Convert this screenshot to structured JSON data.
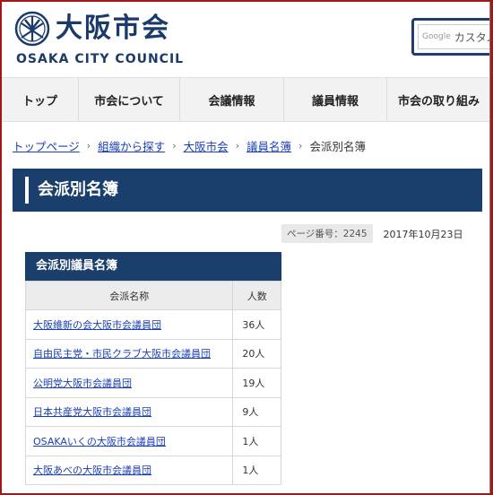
{
  "header": {
    "logo_jp": "大阪市会",
    "logo_en": "OSAKA CITY COUNCIL",
    "search_google": "Google",
    "search_placeholder": "カスタム検"
  },
  "nav": [
    {
      "label": "トップ"
    },
    {
      "label": "市会について"
    },
    {
      "label": "会議情報"
    },
    {
      "label": "議員情報"
    },
    {
      "label": "市会の取り組み"
    }
  ],
  "breadcrumb": {
    "items": [
      "トップページ",
      "組織から探す",
      "大阪市会",
      "議員名簿"
    ],
    "separator": "›",
    "current": "会派別名簿"
  },
  "page_title": "会派別名簿",
  "meta": {
    "page_number": "ページ番号：2245",
    "date": "2017年10月23日"
  },
  "table": {
    "caption": "会派別議員名簿",
    "headers": [
      "会派名称",
      "人数"
    ],
    "rows": [
      {
        "name": "大阪維新の会大阪市会議員団",
        "count": "36人"
      },
      {
        "name": "自由民主党・市民クラブ大阪市会議員団",
        "count": "20人"
      },
      {
        "name": "公明党大阪市会議員団",
        "count": "19人"
      },
      {
        "name": "日本共産党大阪市会議員団",
        "count": "9人"
      },
      {
        "name": "OSAKAいくの大阪市会議員団",
        "count": "1人"
      },
      {
        "name": "大阪あべの大阪市会議員団",
        "count": "1人"
      }
    ]
  },
  "colors": {
    "brand_navy": "#1b3f6c",
    "link_blue": "#1a3fb0",
    "frame_red": "#a01818"
  }
}
